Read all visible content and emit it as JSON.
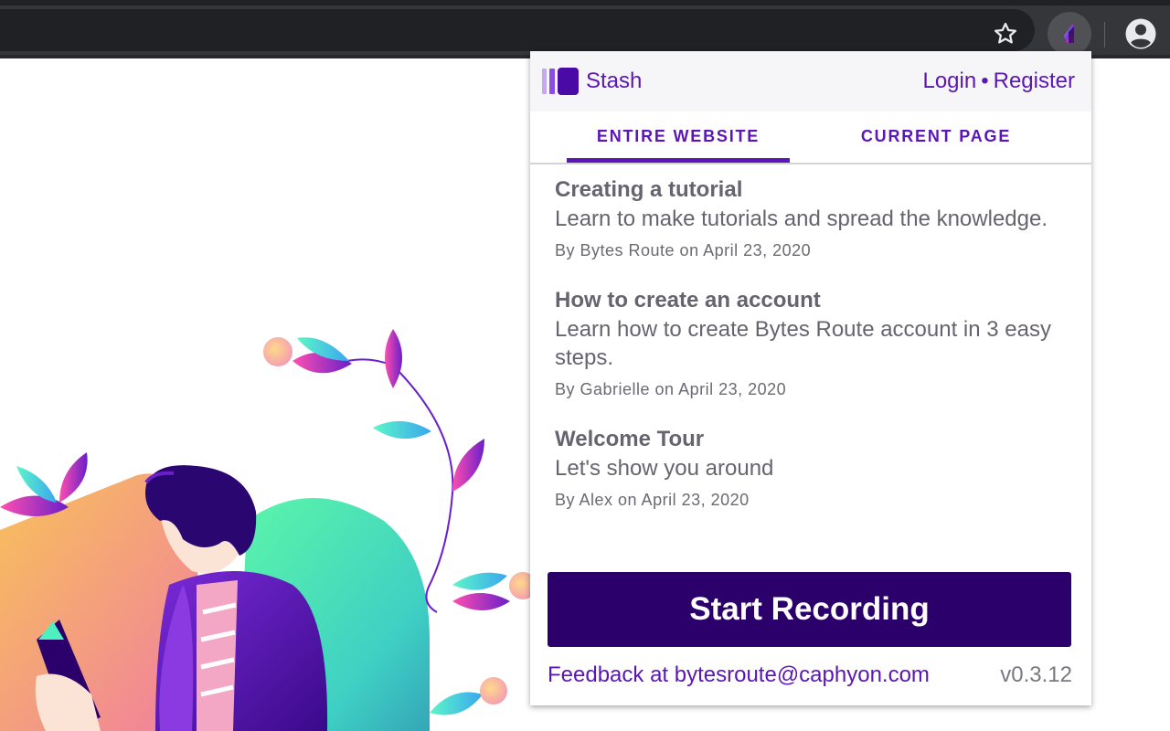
{
  "browser": {
    "star_icon": "star-outline-icon",
    "extension_icon": "stash-extension-icon",
    "profile_icon": "account-circle-icon"
  },
  "popup": {
    "brand": "Stash",
    "login": "Login",
    "separator": "•",
    "register": "Register",
    "tabs": [
      {
        "label": "ENTIRE WEBSITE",
        "active": true
      },
      {
        "label": "CURRENT PAGE",
        "active": false
      }
    ],
    "tutorials": [
      {
        "title": "Creating a tutorial",
        "description": "Learn to make tutorials and spread the knowledge.",
        "meta": "By Bytes Route on April 23, 2020"
      },
      {
        "title": "How to create an account",
        "description": "Learn how to create Bytes Route account in 3 easy steps.",
        "meta": "By Gabrielle on April 23, 2020"
      },
      {
        "title": "Welcome Tour",
        "description": "Let's show you around",
        "meta": "By Alex on April 23, 2020"
      }
    ],
    "record_button": "Start Recording",
    "feedback": "Feedback at bytesroute@caphyon.com",
    "version": "v0.3.12"
  },
  "colors": {
    "accent": "#5a17b3",
    "button_bg": "#2c006a",
    "text_gray": "#66646e",
    "chrome_dark": "#202124"
  }
}
